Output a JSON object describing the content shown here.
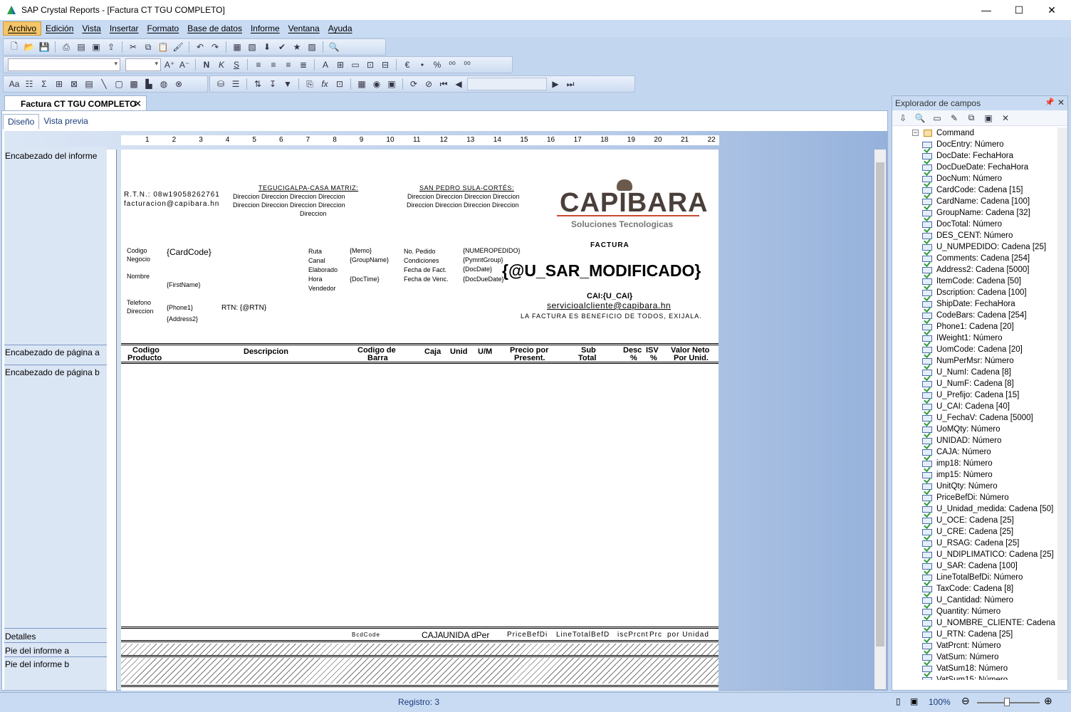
{
  "window": {
    "title": "SAP Crystal Reports - [Factura CT TGU COMPLETO]",
    "minimize_icon": "minimize-icon",
    "maximize_icon": "maximize-icon",
    "close_icon": "close-icon"
  },
  "menu": [
    "Archivo",
    "Edición",
    "Vista",
    "Insertar",
    "Formato",
    "Base de datos",
    "Informe",
    "Ventana",
    "Ayuda"
  ],
  "doc_tab": {
    "label": "Factura CT TGU COMPLETO"
  },
  "view_tabs": {
    "design": "Diseño",
    "preview": "Vista previa"
  },
  "sections": {
    "report_header": "Encabezado del informe",
    "page_header_a": "Encabezado de página a",
    "page_header_b": "Encabezado de página b",
    "details": "Detalles",
    "footer_a": "Pie del informe a",
    "footer_b": "Pie del informe b"
  },
  "ruler": [
    "1",
    "2",
    "3",
    "4",
    "5",
    "6",
    "7",
    "8",
    "9",
    "10",
    "11",
    "12",
    "13",
    "14",
    "15",
    "16",
    "17",
    "18",
    "19",
    "20",
    "21",
    "22"
  ],
  "report": {
    "rtn": "R.T.N.: 08w19058262761",
    "email": "facturacion@capibara.hn",
    "tgu_title": "TEGUCIGALPA-CASA MATRIZ:",
    "tgu_line1": "Direccion Direccion Direccion Direccion",
    "tgu_line2": "Direccion Direccion Direccion Direccion",
    "tgu_line3": "Direccion",
    "sps_title": "SAN PEDRO SULA-CORTÉS:",
    "sps_line1": "Direccion Direccion Direccion Direccion",
    "sps_line2": "Direccion Direccion Direccion Direccion",
    "logo_text": "CAPIBARA",
    "logo_sub": "Soluciones Tecnologicas",
    "factura": "FACTURA",
    "sar_field": "{@U_SAR_MODIFICADO}",
    "cai": "CAI:{U_CAI}",
    "service_email": "servicioalcliente@capibara.hn",
    "benefit": "LA FACTURA ES BENEFICIO DE TODOS, EXIJALA.",
    "lbl_codigo": "Codigo",
    "lbl_negocio": "Negocio",
    "fld_cardcode": "{CardCode}",
    "lbl_nombre": "Nombre",
    "fld_firstname": "{FirstName}",
    "lbl_telefono": "Telefono",
    "lbl_direccion": "Direccion",
    "fld_phone": "{Phone1}",
    "fld_address": "{Address2}",
    "fld_rtn": "RTN: {@RTN}",
    "lbl_ruta": "Ruta",
    "lbl_canal": "Canal",
    "lbl_elaborado": "Elaborado",
    "lbl_hora": "Hora",
    "lbl_vendedor": "Vendedor",
    "fld_memo": "{Memo}",
    "fld_groupname": "{GroupName}",
    "fld_doctime": "{DocTime}",
    "lbl_pedido": "No. Pedido",
    "lbl_condiciones": "Condiciones",
    "lbl_fechafact": "Fecha de Fact.",
    "lbl_fechavenc": "Fecha de Venc.",
    "fld_numpedido": "{NUMEROPEDIDO}",
    "fld_pymnt": "{PymntGroup}",
    "fld_docdate": "{DocDate}",
    "fld_docduedate": "{DocDueDate}",
    "columns": {
      "c1a": "Codigo",
      "c1b": "Producto",
      "c2": "Descripcion",
      "c3a": "Codigo de",
      "c3b": "Barra",
      "c4": "Caja",
      "c5": "Unid",
      "c6": "U/M",
      "c7a": "Precio por",
      "c7b": "Present.",
      "c8a": "Sub",
      "c8b": "Total",
      "c9a": "Desc",
      "c9b": "%",
      "c10a": "ISV",
      "c10b": "%",
      "c11a": "Valor Neto",
      "c11b": "Por Unid."
    },
    "detail": {
      "bcd": "BcdCode",
      "caja": "CAJA",
      "unidad": "UNIDA",
      "per": "dPer",
      "price": "PriceBefDi",
      "linetotal": "LineTotalBefD",
      "disc": "iscPrcnt",
      "prc": "Prc",
      "porunidad": "por Unidad"
    }
  },
  "explorer": {
    "title": "Explorador de campos",
    "pin_icon": "pin-icon",
    "close_icon": "close-icon",
    "root": "Command",
    "fields": [
      "DocEntry: Número",
      "DocDate: FechaHora",
      "DocDueDate: FechaHora",
      "DocNum: Número",
      "CardCode: Cadena [15]",
      "CardName: Cadena [100]",
      "GroupName: Cadena [32]",
      "DocTotal: Número",
      "DES_CENT: Número",
      "U_NUMPEDIDO: Cadena [25]",
      "Comments: Cadena [254]",
      "Address2: Cadena [5000]",
      "ItemCode: Cadena [50]",
      "Dscription: Cadena [100]",
      "ShipDate: FechaHora",
      "CodeBars: Cadena [254]",
      "Phone1: Cadena [20]",
      "IWeight1: Número",
      "UomCode: Cadena [20]",
      "NumPerMsr: Número",
      "U_NumI: Cadena [8]",
      "U_NumF: Cadena [8]",
      "U_Prefijo: Cadena [15]",
      "U_CAI: Cadena [40]",
      "U_FechaV: Cadena [5000]",
      "UoMQty: Número",
      "UNIDAD: Número",
      "CAJA: Número",
      "imp18: Número",
      "imp15: Número",
      "UnitQty: Número",
      "PriceBefDi: Número",
      "U_Unidad_medida: Cadena [50]",
      "U_OCE: Cadena [25]",
      "U_CRE: Cadena [25]",
      "U_RSAG: Cadena [25]",
      "U_NDIPLIMATICO: Cadena [25]",
      "U_SAR: Cadena [100]",
      "LineTotalBefDi: Número",
      "TaxCode: Cadena [8]",
      "U_Cantidad: Número",
      "Quantity: Número",
      "U_NOMBRE_CLIENTE: Cadena",
      "U_RTN: Cadena [25]",
      "VatPrcnt: Número",
      "VatSum: Número",
      "VatSum18: Número",
      "VatSum15: Número"
    ]
  },
  "status": {
    "record": "Registro: 3",
    "zoom": "100%"
  }
}
